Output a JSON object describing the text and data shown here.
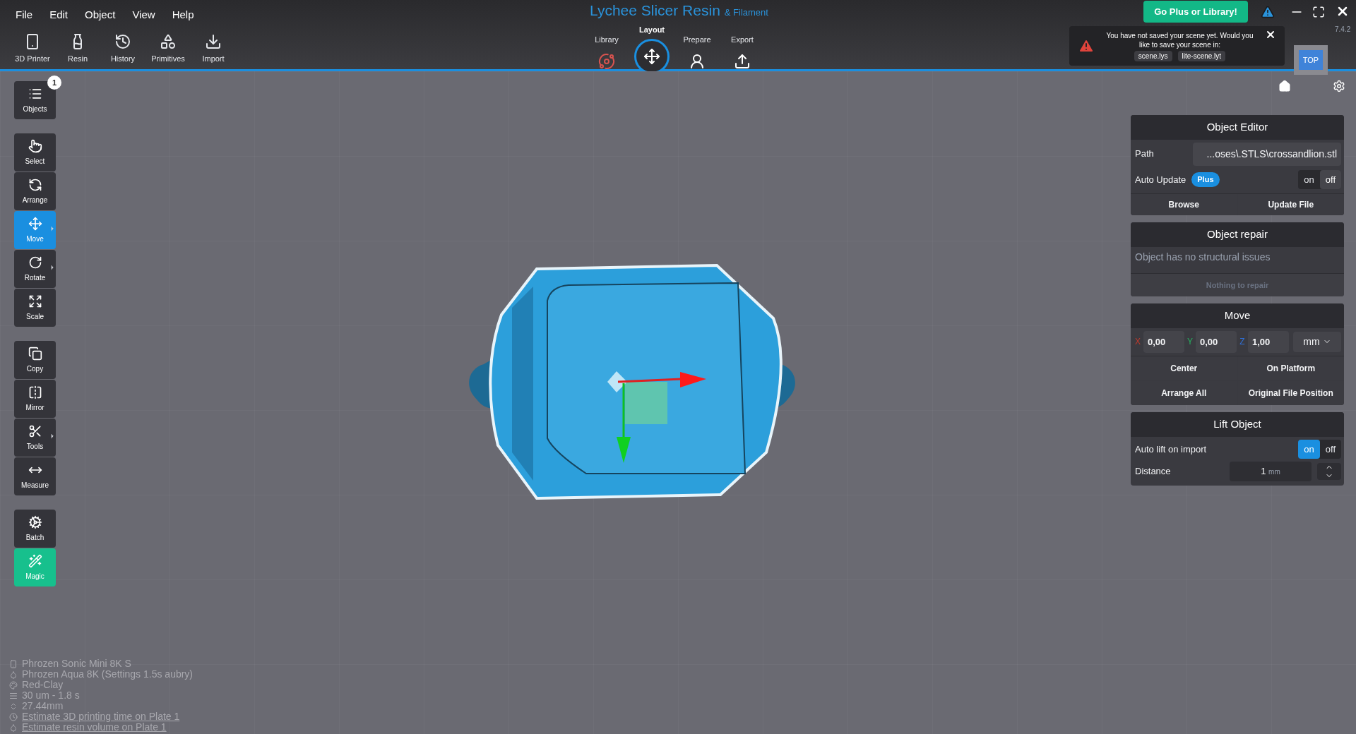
{
  "menu": [
    "File",
    "Edit",
    "Object",
    "View",
    "Help"
  ],
  "toolbar": [
    "3D Printer",
    "Resin",
    "History",
    "Primitives",
    "Import"
  ],
  "app_title": {
    "name": "Lychee Slicer Resin",
    "suffix": "& Filament"
  },
  "workflow_tabs": [
    {
      "label": "Library",
      "selected": false
    },
    {
      "label": "Layout",
      "selected": true
    },
    {
      "label": "Prepare",
      "selected": false
    },
    {
      "label": "Export",
      "selected": false
    }
  ],
  "plus_button": "Go Plus or Library!",
  "version": "7.4.2",
  "notification": {
    "message": "You have not saved your scene yet. Would you like to save your scene in:",
    "files": [
      "scene.lys",
      "lite-scene.lyt"
    ]
  },
  "view_button": "TOP",
  "tool_groups": [
    [
      {
        "label": "Objects",
        "selected": false,
        "kind": "tool",
        "has_submenu": false,
        "badge": "1"
      }
    ],
    [
      {
        "label": "Select",
        "selected": false,
        "kind": "tool",
        "has_submenu": false
      },
      {
        "label": "Arrange",
        "selected": false,
        "kind": "tool",
        "has_submenu": false
      },
      {
        "label": "Move",
        "selected": true,
        "kind": "tool",
        "has_submenu": true
      },
      {
        "label": "Rotate",
        "selected": false,
        "kind": "tool",
        "has_submenu": true
      },
      {
        "label": "Scale",
        "selected": false,
        "kind": "tool",
        "has_submenu": false
      }
    ],
    [
      {
        "label": "Copy",
        "selected": false,
        "kind": "tool",
        "has_submenu": false
      },
      {
        "label": "Mirror",
        "selected": false,
        "kind": "tool",
        "has_submenu": false
      },
      {
        "label": "Tools",
        "selected": false,
        "kind": "tool",
        "has_submenu": true
      },
      {
        "label": "Measure",
        "selected": false,
        "kind": "tool",
        "has_submenu": false
      }
    ],
    [
      {
        "label": "Batch",
        "selected": false,
        "kind": "tool",
        "has_submenu": false
      },
      {
        "label": "Magic",
        "selected": false,
        "kind": "feature",
        "has_submenu": false
      }
    ]
  ],
  "object_editor": {
    "title": "Object Editor",
    "path_label": "Path",
    "path": "...oses\\.STLS\\crossandlion.stl",
    "auto_update": {
      "label": "Auto Update",
      "badge": "Plus",
      "on_label": "on",
      "off_label": "off",
      "on": false
    },
    "buttons": [
      "Browse",
      "Update File"
    ]
  },
  "object_repair": {
    "title": "Object repair",
    "message": "Object has no structural issues",
    "button": {
      "label": "Nothing to repair",
      "disabled": true
    }
  },
  "move": {
    "title": "Move",
    "axes": [
      {
        "axis": "X",
        "color": "#c0392b",
        "value": "0,00"
      },
      {
        "axis": "Y",
        "color": "#27ae60",
        "value": "0,00"
      },
      {
        "axis": "Z",
        "color": "#2f6fd6",
        "value": "1,00"
      }
    ],
    "unit": "mm",
    "buttons": [
      "Center",
      "On Platform",
      "Arrange All",
      "Original File Position"
    ]
  },
  "lift_object": {
    "title": "Lift Object",
    "auto_lift": {
      "label": "Auto lift on import",
      "on_label": "on",
      "off_label": "off",
      "on": true
    },
    "distance": {
      "label": "Distance",
      "value": "1",
      "unit": "mm"
    }
  },
  "scene_info": [
    {
      "text": "Phrozen Sonic Mini 8K S",
      "link": false
    },
    {
      "text": "Phrozen Aqua 8K (Settings 1.5s aubry)",
      "link": false
    },
    {
      "text": "Red-Clay",
      "link": false
    },
    {
      "text": "30 um - 1.8 s",
      "link": false
    },
    {
      "text": "27.44mm",
      "link": false
    },
    {
      "text": "Estimate 3D printing time on Plate 1",
      "link": true
    },
    {
      "text": "Estimate resin volume on Plate 1",
      "link": true
    }
  ]
}
